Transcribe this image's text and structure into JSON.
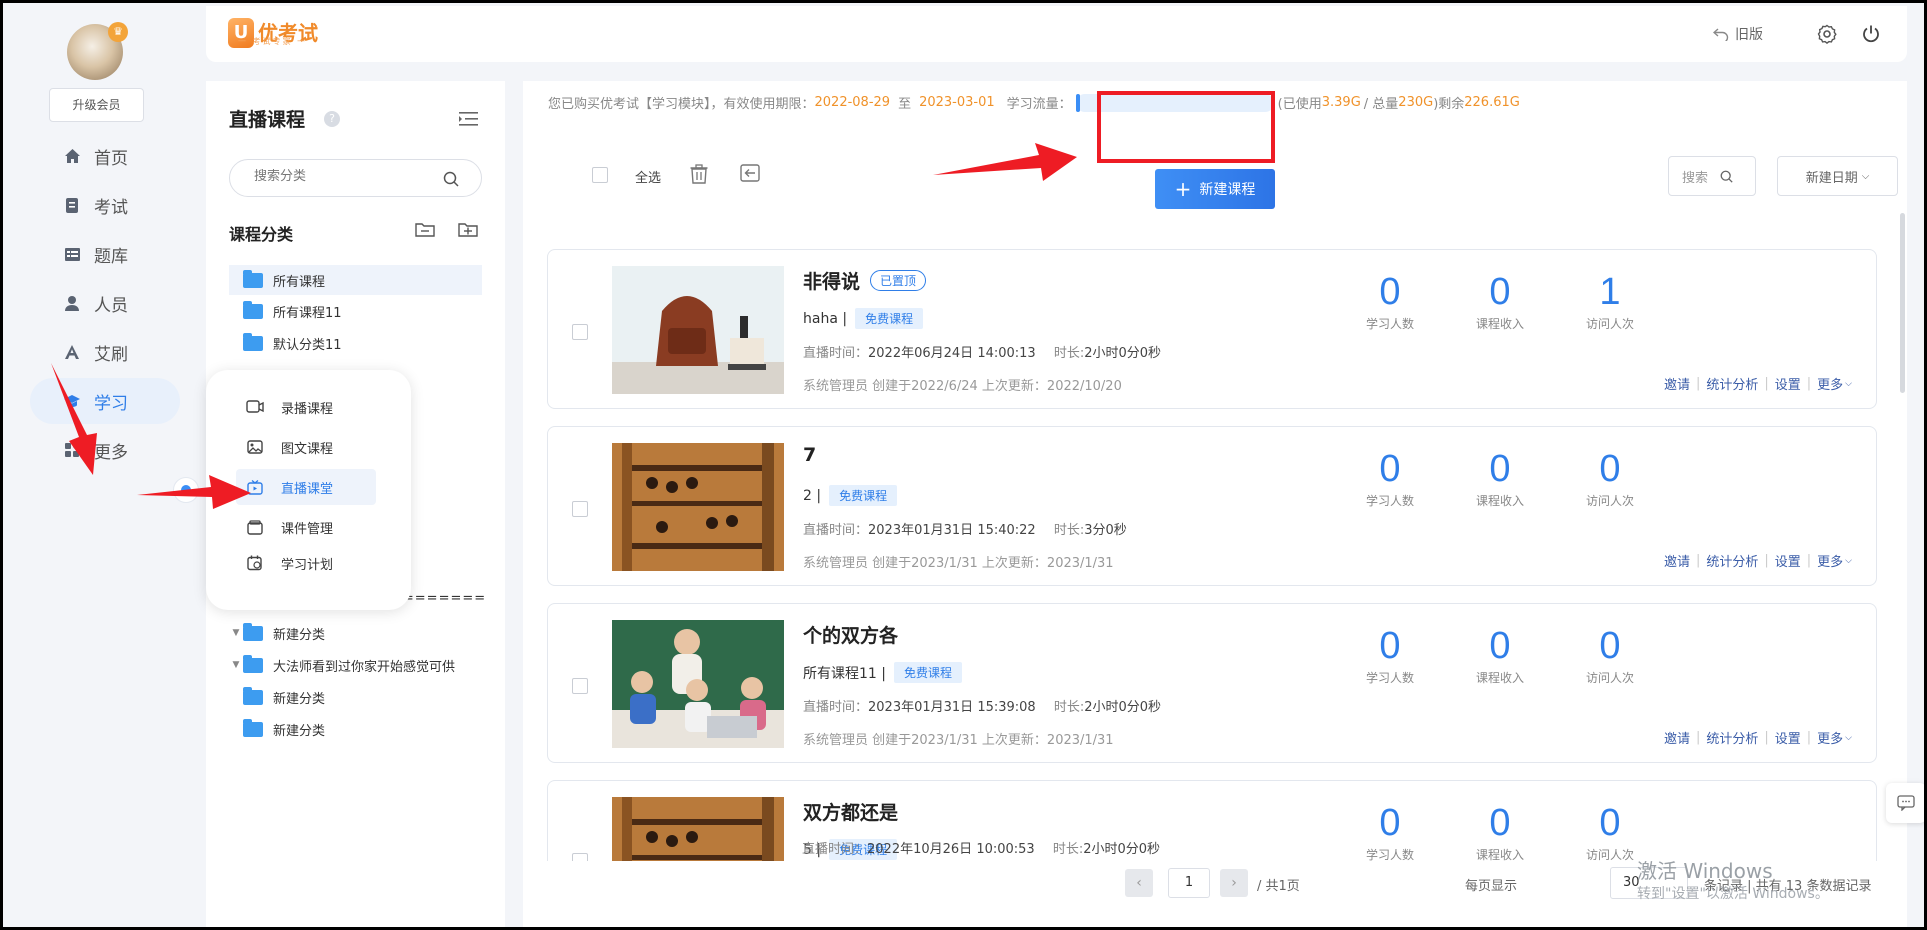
{
  "nav": {
    "upgrade_label": "升级会员",
    "items": [
      {
        "label": "首页",
        "icon": "home-icon"
      },
      {
        "label": "考试",
        "icon": "exam-icon"
      },
      {
        "label": "题库",
        "icon": "question-bank-icon"
      },
      {
        "label": "人员",
        "icon": "user-icon"
      },
      {
        "label": "艾刷",
        "icon": "a-icon"
      },
      {
        "label": "学习",
        "icon": "graduation-cap-icon"
      },
      {
        "label": "更多",
        "icon": "grid-icon"
      }
    ]
  },
  "header": {
    "logo_text": "优考试",
    "logo_subtitle": "一 考试专家 一",
    "old_version_label": "旧版"
  },
  "category_panel": {
    "title": "直播课程",
    "help_mark": "?",
    "search_placeholder": "搜索分类",
    "section_title": "课程分类",
    "dashes": "========",
    "tree": [
      {
        "label": "所有课程"
      },
      {
        "label": "所有课程11"
      },
      {
        "label": "默认分类11"
      },
      {
        "label": "新建分类"
      },
      {
        "label": "大法师看到过你家开始感觉可供"
      },
      {
        "label": "新建分类"
      },
      {
        "label": "新建分类"
      }
    ]
  },
  "popup_menu": {
    "items": [
      {
        "label": "录播课程",
        "icon": "video-icon"
      },
      {
        "label": "图文课程",
        "icon": "image-icon"
      },
      {
        "label": "直播课堂",
        "icon": "live-tv-icon"
      },
      {
        "label": "课件管理",
        "icon": "courseware-icon"
      },
      {
        "label": "学习计划",
        "icon": "calendar-icon"
      }
    ]
  },
  "info": {
    "prefix": "您已购买优考试【学习模块】，有效使用期限：",
    "start_date": "2022-08-29",
    "to": "至",
    "end_date": "2023-03-01",
    "flow_label": "学习流量：",
    "used_prefix": "(已使用",
    "used": "3.39G",
    "total_prefix": "/ 总量",
    "total": "230G",
    "remaining_prefix": ")剩余",
    "remaining": "226.61G",
    "usage_fraction": 0.015
  },
  "toolbar": {
    "select_all": "全选",
    "new_course": "新建课程",
    "search_label": "搜索",
    "sort_label": "新建日期"
  },
  "courses": [
    {
      "title": "非得说",
      "pinned_label": "已置顶",
      "category": "haha |",
      "free_label": "免费课程",
      "time_label": "直播时间：",
      "time": "2022年06月24日 14:00:13",
      "duration_label": "时长:",
      "duration": "2小时0分0秒",
      "meta": "系统管理员 创建于2022/6/24  上次更新：2022/10/20",
      "learners": "0",
      "revenue": "0",
      "visits": "1"
    },
    {
      "title": "7",
      "pinned_label": "",
      "category": "2 |",
      "free_label": "免费课程",
      "time_label": "直播时间：",
      "time": "2023年01月31日 15:40:22",
      "duration_label": "时长:",
      "duration": "3分0秒",
      "meta": "系统管理员 创建于2023/1/31  上次更新：2023/1/31",
      "learners": "0",
      "revenue": "0",
      "visits": "0"
    },
    {
      "title": "个的双方各",
      "pinned_label": "",
      "category": "所有课程11 |",
      "free_label": "免费课程",
      "time_label": "直播时间：",
      "time": "2023年01月31日 15:39:08",
      "duration_label": "时长:",
      "duration": "2小时0分0秒",
      "meta": "系统管理员 创建于2023/1/31  上次更新：2023/1/31",
      "learners": "0",
      "revenue": "0",
      "visits": "0"
    },
    {
      "title": "双方都还是",
      "pinned_label": "",
      "category": "5 |",
      "free_label": "免费课程",
      "time_label": "直播时间：",
      "time": "2022年10月26日 10:00:53",
      "duration_label": "时长:",
      "duration": "2小时0分0秒",
      "meta": "",
      "learners": "0",
      "revenue": "0",
      "visits": "0"
    }
  ],
  "stat_labels": {
    "learners": "学习人数",
    "revenue": "课程收入",
    "visits": "访问人次"
  },
  "card_actions": {
    "invite": "邀请",
    "analysis": "统计分析",
    "settings": "设置",
    "more": "更多"
  },
  "pager": {
    "current_page": "1",
    "total_pages": "/ 共1页",
    "per_page_label": "每页显示",
    "per_page": "30",
    "records_text": "条记录 | 共有 13 条数据记录"
  },
  "watermark": {
    "title": "激活 Windows",
    "subtitle": "转到\"设置\"以激活 Windows。"
  },
  "colors": {
    "accent": "#2f7ee8",
    "orange": "#f0922a",
    "annotation_red": "#ee1c24"
  }
}
